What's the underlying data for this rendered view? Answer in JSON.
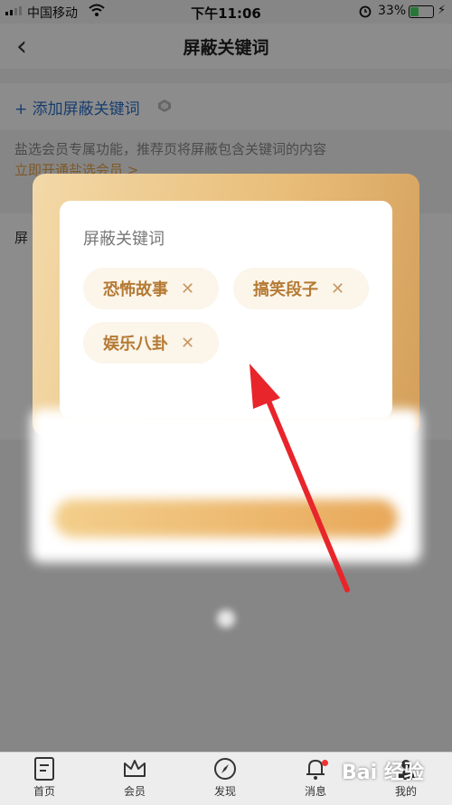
{
  "status_bar": {
    "carrier": "中国移动",
    "time": "下午11:06",
    "battery_percent": "33%",
    "battery_level": 0.33
  },
  "header": {
    "title": "屏蔽关键词",
    "back_icon": "chevron-left-icon"
  },
  "page": {
    "add_keyword_label": "+ 添加屏蔽关键词",
    "member_note": "盐选会员专属功能，推荐页将屏蔽包含关键词的内容",
    "member_link": "立即开通盐选会员 >",
    "blocked_section_label": "屏"
  },
  "popup": {
    "heading": "屏蔽关键词",
    "keywords": [
      "恐怖故事",
      "搞笑段子",
      "娱乐八卦"
    ],
    "blurred_title": "",
    "blurred_button": ""
  },
  "tabbar": {
    "items": [
      {
        "label": "首页",
        "icon": "document-icon"
      },
      {
        "label": "会员",
        "icon": "crown-icon"
      },
      {
        "label": "发现",
        "icon": "compass-icon"
      },
      {
        "label": "消息",
        "icon": "bell-icon"
      },
      {
        "label": "我的",
        "icon": "person-icon"
      }
    ]
  },
  "watermark": "Bai 经验",
  "colors": {
    "accent_blue": "#2a6fc9",
    "gold": "#e3a24a",
    "chip_text": "#b57a34",
    "arrow_red": "#e8252b"
  }
}
